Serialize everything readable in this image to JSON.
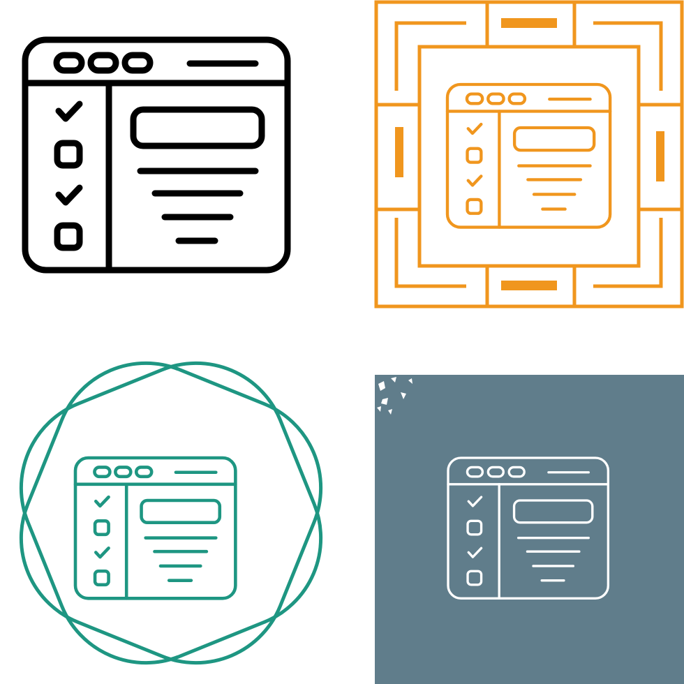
{
  "icon_name": "checklist-browser-window-icon",
  "variants": [
    {
      "id": "black",
      "style": "line",
      "stroke": "#000000"
    },
    {
      "id": "orange",
      "style": "framed-line",
      "stroke": "#F0961E"
    },
    {
      "id": "teal",
      "style": "badge-line",
      "stroke": "#1E9682"
    },
    {
      "id": "slate",
      "style": "inverted-line",
      "stroke": "#FFFFFF",
      "background": "#607D8B"
    }
  ],
  "colors": {
    "page_background": "#FFFFFF",
    "black": "#000000",
    "orange": "#F0961E",
    "teal": "#1E9682",
    "slate_background": "#607D8B",
    "white": "#FFFFFF"
  }
}
